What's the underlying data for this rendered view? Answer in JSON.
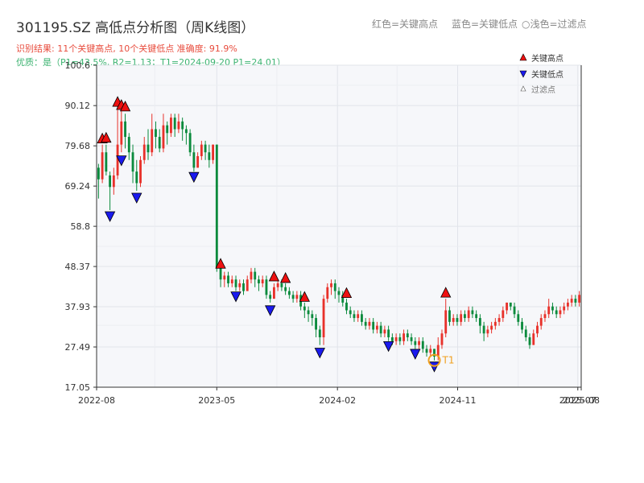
{
  "header": {
    "title": "301195.SZ 高低点分析图（周K线图）",
    "legend_red": "红色=关键高点",
    "legend_blue": "蓝色=关键低点",
    "legend_filtered": "○浅色=过滤点",
    "result_line": "识别结果: 11个关键高点, 10个关键低点  准确度: 91.9%",
    "quality_line": "优质：是（P1=43.5%, R2=1.13；T1=2024-09-20 P1=24.01）"
  },
  "colors": {
    "up": "#e8312a",
    "down": "#0a8a3c",
    "high_marker": "#ee1111",
    "low_marker": "#1a1aee",
    "t1": "#f0a020",
    "plot_bg": "#f6f7fa",
    "result_text": "#e84c3d",
    "quality_text": "#3cb371"
  },
  "chart_data": {
    "type": "candlestick",
    "x_ticks": [
      "2022-08",
      "2023-05",
      "2024-02",
      "2024-11",
      "2025-07",
      "2025-08"
    ],
    "y_ticks": [
      17.05,
      27.49,
      37.93,
      48.37,
      58.8,
      69.24,
      79.68,
      90.12,
      100.6
    ],
    "ylim": [
      17.05,
      100.6
    ],
    "legend": [
      "关键高点",
      "关键低点",
      "过滤点"
    ],
    "t1_label": "T1",
    "key_highs": [
      80.0,
      89.5,
      88.7,
      88.3,
      80.2,
      47.5,
      44.2,
      43.8,
      38.9,
      39.9,
      40.0
    ],
    "key_lows": [
      63.0,
      67.8,
      77.5,
      73.2,
      42.2,
      38.6,
      27.6,
      24.01,
      29.3,
      27.3
    ],
    "t1_value": 24.01,
    "candles": [
      [
        74,
        71,
        75,
        66
      ],
      [
        71,
        78,
        80,
        70
      ],
      [
        78,
        73,
        80,
        72
      ],
      [
        72,
        69,
        73,
        63
      ],
      [
        69,
        72,
        74,
        67
      ],
      [
        72,
        80,
        90,
        71
      ],
      [
        80,
        86,
        89,
        78
      ],
      [
        86,
        82,
        88,
        79
      ],
      [
        82,
        78,
        83,
        76
      ],
      [
        78,
        73,
        80,
        70
      ],
      [
        73,
        70,
        76,
        68
      ],
      [
        70,
        76,
        77,
        69
      ],
      [
        76,
        80,
        82,
        75
      ],
      [
        80,
        78,
        84,
        76
      ],
      [
        78,
        84,
        88,
        77
      ],
      [
        84,
        82,
        86,
        79
      ],
      [
        82,
        79,
        84,
        78
      ],
      [
        79,
        85,
        88,
        78
      ],
      [
        85,
        83,
        86,
        80
      ],
      [
        83,
        87,
        88,
        82
      ],
      [
        87,
        84,
        88,
        82
      ],
      [
        84,
        86,
        88,
        83
      ],
      [
        86,
        84,
        87,
        81
      ],
      [
        84,
        83,
        85,
        80
      ],
      [
        83,
        78,
        84,
        77
      ],
      [
        78,
        74,
        80,
        73
      ],
      [
        74,
        77,
        78,
        74
      ],
      [
        77,
        80,
        81,
        76
      ],
      [
        80,
        78,
        81,
        76
      ],
      [
        78,
        76,
        80,
        74
      ],
      [
        76,
        80,
        80,
        75
      ],
      [
        80,
        48,
        80,
        47
      ],
      [
        48,
        45,
        48,
        43
      ],
      [
        45,
        46,
        47,
        43
      ],
      [
        46,
        44,
        47,
        43
      ],
      [
        44,
        45,
        46,
        43
      ],
      [
        45,
        43,
        46,
        42
      ],
      [
        43,
        44,
        45,
        42
      ],
      [
        44,
        42,
        45,
        41
      ],
      [
        42,
        45,
        46,
        42
      ],
      [
        45,
        47,
        48,
        44
      ],
      [
        47,
        45,
        48,
        43
      ],
      [
        45,
        44,
        46,
        42
      ],
      [
        44,
        45,
        46,
        43
      ],
      [
        45,
        41,
        46,
        40
      ],
      [
        41,
        40,
        42,
        39
      ],
      [
        40,
        43,
        44,
        40
      ],
      [
        43,
        44,
        45,
        42
      ],
      [
        44,
        43,
        45,
        42
      ],
      [
        43,
        42,
        44,
        41
      ],
      [
        42,
        41,
        43,
        40
      ],
      [
        41,
        40,
        42,
        39
      ],
      [
        40,
        41,
        42,
        39
      ],
      [
        41,
        38,
        42,
        37
      ],
      [
        38,
        37,
        39,
        35
      ],
      [
        37,
        36,
        38,
        34
      ],
      [
        36,
        35,
        37,
        33
      ],
      [
        35,
        32,
        36,
        30
      ],
      [
        32,
        30,
        33,
        28
      ],
      [
        30,
        40,
        41,
        28
      ],
      [
        40,
        43,
        44,
        39
      ],
      [
        43,
        44,
        45,
        41
      ],
      [
        44,
        42,
        45,
        40
      ],
      [
        42,
        41,
        43,
        39
      ],
      [
        41,
        39,
        42,
        38
      ],
      [
        39,
        37,
        40,
        36
      ],
      [
        37,
        36,
        38,
        35
      ],
      [
        36,
        35,
        37,
        34
      ],
      [
        35,
        36,
        37,
        34
      ],
      [
        36,
        34,
        37,
        33
      ],
      [
        34,
        33,
        35,
        32
      ],
      [
        33,
        34,
        35,
        32
      ],
      [
        34,
        32,
        35,
        31
      ],
      [
        32,
        33,
        34,
        31
      ],
      [
        33,
        31,
        34,
        30
      ],
      [
        31,
        32,
        33,
        30
      ],
      [
        32,
        30,
        33,
        29
      ],
      [
        30,
        29,
        31,
        28
      ],
      [
        29,
        30,
        31,
        28
      ],
      [
        30,
        29,
        31,
        28
      ],
      [
        29,
        31,
        32,
        28
      ],
      [
        31,
        30,
        32,
        29
      ],
      [
        30,
        29,
        31,
        28
      ],
      [
        29,
        28,
        30,
        27
      ],
      [
        28,
        29,
        30,
        27
      ],
      [
        29,
        27,
        30,
        26
      ],
      [
        27,
        26,
        28,
        25
      ],
      [
        26,
        27,
        28,
        25
      ],
      [
        27,
        25,
        27,
        24
      ],
      [
        25,
        28,
        30,
        24
      ],
      [
        28,
        31,
        32,
        27
      ],
      [
        31,
        37,
        40,
        30
      ],
      [
        37,
        34,
        38,
        33
      ],
      [
        34,
        35,
        36,
        33
      ],
      [
        35,
        34,
        36,
        33
      ],
      [
        34,
        36,
        37,
        33
      ],
      [
        36,
        35,
        37,
        34
      ],
      [
        35,
        37,
        38,
        34
      ],
      [
        37,
        36,
        38,
        35
      ],
      [
        36,
        35,
        37,
        34
      ],
      [
        35,
        33,
        36,
        31
      ],
      [
        33,
        31,
        34,
        29
      ],
      [
        31,
        32,
        33,
        30
      ],
      [
        32,
        33,
        34,
        31
      ],
      [
        33,
        34,
        35,
        32
      ],
      [
        34,
        35,
        36,
        33
      ],
      [
        35,
        37,
        38,
        34
      ],
      [
        37,
        39,
        39,
        36
      ],
      [
        39,
        38,
        39,
        37
      ],
      [
        38,
        36,
        39,
        35
      ],
      [
        36,
        34,
        37,
        33
      ],
      [
        34,
        32,
        35,
        31
      ],
      [
        32,
        30,
        33,
        29
      ],
      [
        30,
        28,
        31,
        27
      ],
      [
        28,
        31,
        32,
        28
      ],
      [
        31,
        33,
        34,
        30
      ],
      [
        33,
        35,
        36,
        32
      ],
      [
        35,
        36,
        37,
        34
      ],
      [
        36,
        38,
        40,
        35
      ],
      [
        38,
        37,
        39,
        36
      ],
      [
        37,
        36,
        38,
        35
      ],
      [
        36,
        37,
        38,
        35
      ],
      [
        37,
        38,
        39,
        36
      ],
      [
        38,
        39,
        40,
        37
      ],
      [
        39,
        40,
        41,
        38
      ],
      [
        40,
        39,
        41,
        38
      ],
      [
        39,
        41,
        42,
        38
      ]
    ]
  }
}
